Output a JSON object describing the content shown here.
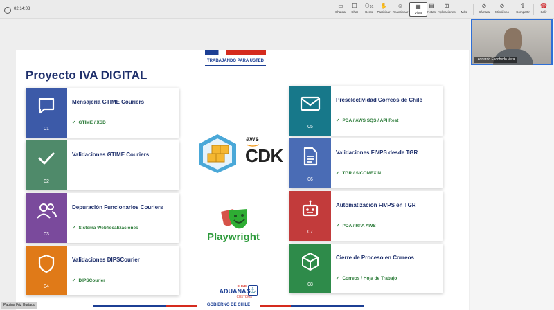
{
  "meeting": {
    "timer": "02:14:08",
    "toolbar": [
      {
        "label": "Chatear",
        "icon": "chat-icon"
      },
      {
        "label": "Chat",
        "icon": "chat-bubble-icon"
      },
      {
        "label": "Gente",
        "icon": "people-icon",
        "badge": "61"
      },
      {
        "label": "Participar",
        "icon": "raise-hand-icon"
      },
      {
        "label": "Reaccionar",
        "icon": "emoji-icon"
      },
      {
        "label": "Vista",
        "icon": "view-icon",
        "selected": true
      },
      {
        "label": "Notas",
        "icon": "notes-icon"
      },
      {
        "label": "Aplicaciones",
        "icon": "apps-icon"
      },
      {
        "label": "Más",
        "icon": "more-icon"
      },
      {
        "label": "Cámara",
        "icon": "camera-off-icon"
      },
      {
        "label": "Micrófono",
        "icon": "mic-off-icon"
      },
      {
        "label": "Compartir",
        "icon": "share-icon"
      },
      {
        "label": "Salir",
        "icon": "leave-icon"
      }
    ],
    "participant_video_name": "Leonardo Escobedo Vera",
    "self_name": "Paulina Friz Hurtado"
  },
  "slide": {
    "header_tagline": "TRABAJANDO PARA USTED",
    "title": "Proyecto IVA DIGITAL",
    "cards_left": [
      {
        "number": "01",
        "title": "Mensajería GTIME Couriers",
        "subtitle": "GTIME / XSD",
        "color": "#3c5aa8",
        "icon": "message-icon"
      },
      {
        "number": "02",
        "title": "Validaciones GTIME Couriers",
        "subtitle": "",
        "color": "#4f8a6a",
        "icon": "checkmark-icon"
      },
      {
        "number": "03",
        "title": "Depuración Funcionarios Couriers",
        "subtitle": "Sistema Webfiscalizaciones",
        "color": "#7a4a9c",
        "icon": "users-icon"
      },
      {
        "number": "04",
        "title": "Validaciones DIPSCourier",
        "subtitle": "DIPSCourier",
        "color": "#e07a18",
        "icon": "shield-icon"
      }
    ],
    "cards_right": [
      {
        "number": "05",
        "title": "Preselectividad Correos de Chile",
        "subtitle": "PDA / AWS SQS / API Rest",
        "color": "#17788a",
        "icon": "mail-icon"
      },
      {
        "number": "06",
        "title": "Validaciones FIVPS desde TGR",
        "subtitle": "TGR / SICOMEXIN",
        "color": "#4a6cb5",
        "icon": "document-icon"
      },
      {
        "number": "07",
        "title": "Automatización FIVPS en TGR",
        "subtitle": "PDA / RPA AWS",
        "color": "#c23b3b",
        "icon": "robot-icon"
      },
      {
        "number": "08",
        "title": "Cierre de Proceso en Correos",
        "subtitle": "Correos / Hoja de Trabajo",
        "color": "#2e8b4a",
        "icon": "box-icon"
      }
    ],
    "center": {
      "aws_label": "aws",
      "cdk_label": "CDK",
      "playwright_label": "Playwright"
    },
    "footer": {
      "chile": "CHILE",
      "aduanas": "ADUANAS",
      "customs": "CUSTOMS",
      "gobierno": "GOBIERNO DE CHILE"
    }
  }
}
